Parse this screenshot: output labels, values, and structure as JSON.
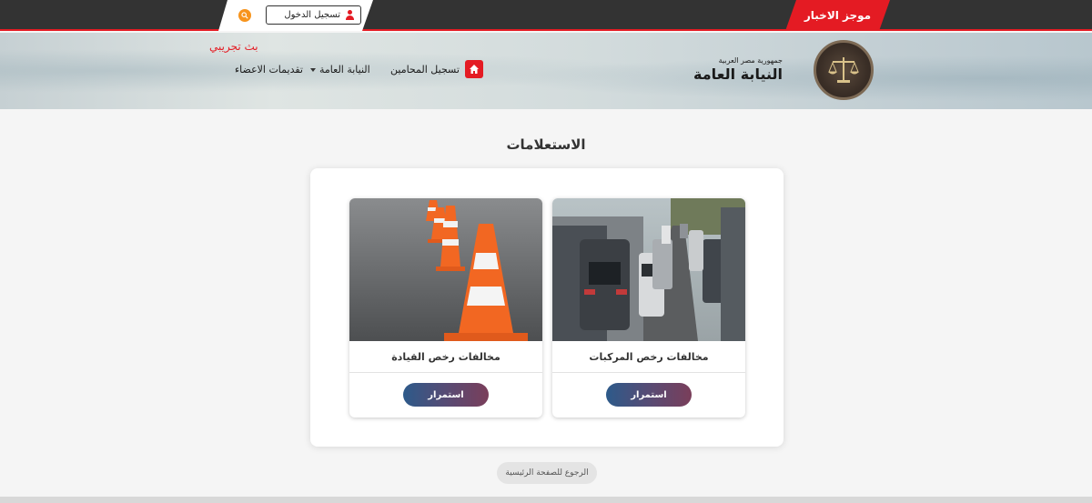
{
  "topbar": {
    "news_label": "موجز الاخبار",
    "login_label": "تسجيل الدخول"
  },
  "header": {
    "brand_sub": "جمهورية مصر العربية",
    "brand_main": "النيابة العامة",
    "live_label": "بث تجريبي",
    "nav": {
      "lawyers": "تسجيل المحامين",
      "prosecution": "النيابة العامة",
      "members": "تقديمات الاعضاء"
    }
  },
  "main": {
    "title": "الاستعلامات",
    "cards": [
      {
        "title": "مخالفات رخص المركبات",
        "button": "استمرار"
      },
      {
        "title": "مخالفات رخص القيادة",
        "button": "استمرار"
      }
    ],
    "back_label": "الرجوع للصفحة الرئيسية"
  },
  "colors": {
    "accent_red": "#e41b23",
    "search_orange": "#f7941d",
    "topbar_dark": "#333333",
    "button_gradient_start": "#2d5a8a",
    "button_gradient_end": "#7a3e5a"
  }
}
